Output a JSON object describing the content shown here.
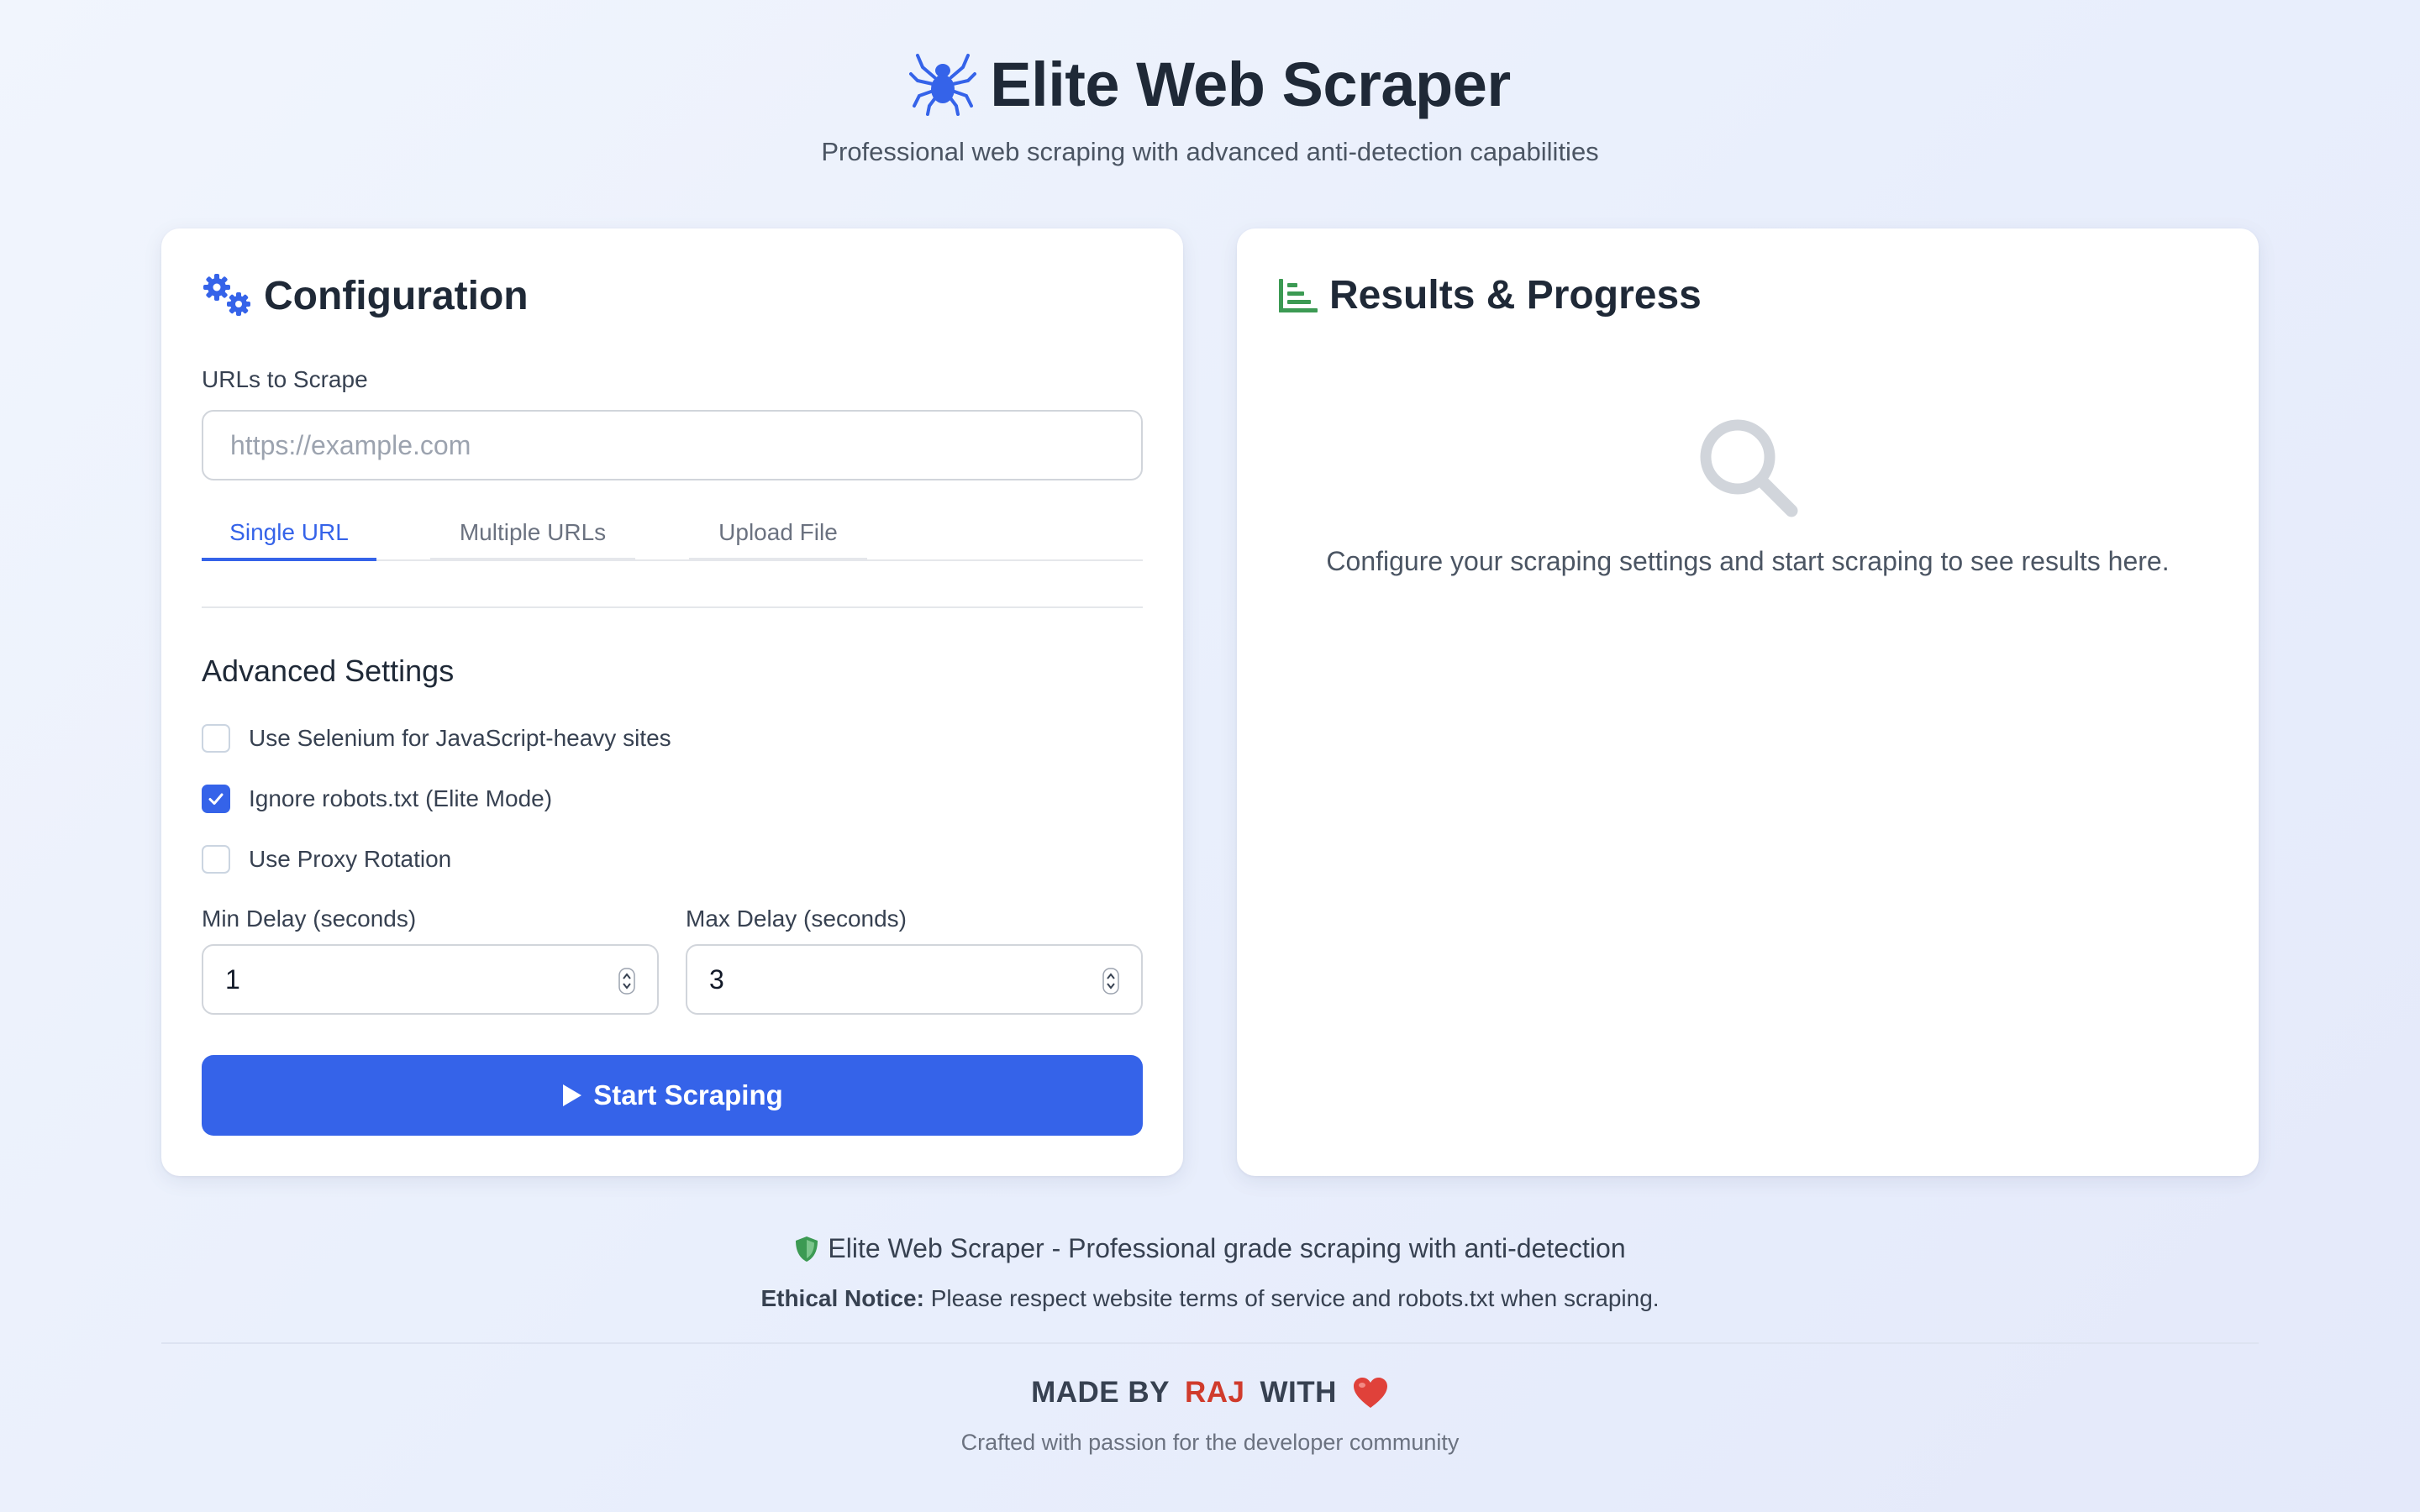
{
  "header": {
    "title": "Elite Web Scraper",
    "subtitle": "Professional web scraping with advanced anti-detection capabilities",
    "icon": "spider-icon"
  },
  "config": {
    "title": "Configuration",
    "icon": "gears-icon",
    "urls_label": "URLs to Scrape",
    "url_placeholder": "https://example.com",
    "url_value": "",
    "tabs": [
      {
        "label": "Single URL",
        "active": true
      },
      {
        "label": "Multiple URLs",
        "active": false
      },
      {
        "label": "Upload File",
        "active": false
      }
    ],
    "advanced_title": "Advanced Settings",
    "options": [
      {
        "label": "Use Selenium for JavaScript-heavy sites",
        "checked": false
      },
      {
        "label": "Ignore robots.txt (Elite Mode)",
        "checked": true
      },
      {
        "label": "Use Proxy Rotation",
        "checked": false
      }
    ],
    "min_delay_label": "Min Delay (seconds)",
    "min_delay_value": "1",
    "max_delay_label": "Max Delay (seconds)",
    "max_delay_value": "3",
    "start_label": "Start Scraping"
  },
  "results": {
    "title": "Results & Progress",
    "icon": "chart-bar-icon",
    "empty_icon": "search-icon",
    "empty_text": "Configure your scraping settings and start scraping to see results here."
  },
  "footer": {
    "tagline": "Elite Web Scraper - Professional grade scraping with anti-detection",
    "notice_label": "Ethical Notice:",
    "notice_text": "Please respect website terms of service and robots.txt when scraping.",
    "made_by": "MADE BY",
    "author": "RAJ",
    "with": "WITH",
    "crafted": "Crafted with passion for the developer community"
  },
  "colors": {
    "accent": "#3563e9",
    "green": "#3c9a53",
    "author": "#d03b2c",
    "heart": "#e0413a"
  }
}
